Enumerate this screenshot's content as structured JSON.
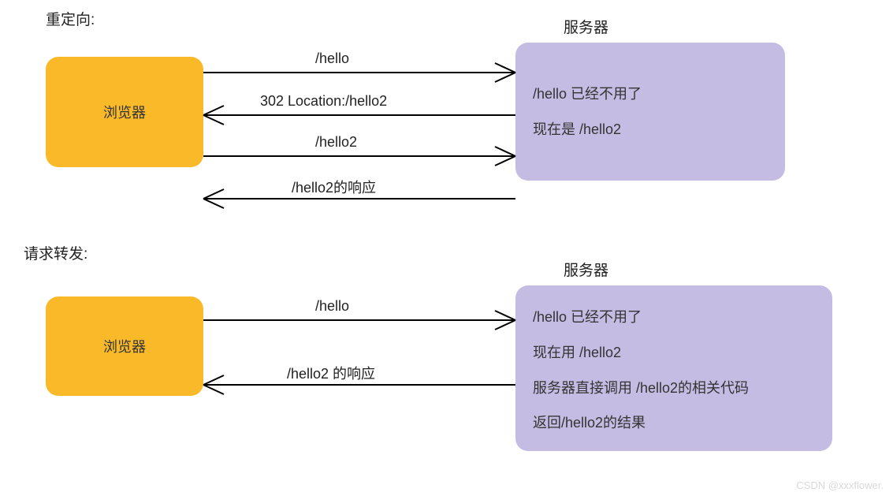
{
  "section1": {
    "title": "重定向:",
    "browser_label": "浏览器",
    "server_label": "服务器",
    "arrow1": "/hello",
    "arrow2": "302 Location:/hello2",
    "arrow3": "/hello2",
    "arrow4": "/hello2的响应",
    "server_text1": "/hello  已经不用了",
    "server_text2": "现在是  /hello2"
  },
  "section2": {
    "title": "请求转发:",
    "browser_label": "浏览器",
    "server_label": "服务器",
    "arrow1": "/hello",
    "arrow2": "/hello2 的响应",
    "server_text1": "/hello 已经不用了",
    "server_text2": "现在用  /hello2",
    "server_text3": "服务器直接调用 /hello2的相关代码",
    "server_text4": "返回/hello2的结果"
  },
  "watermark": "CSDN @xxxflower."
}
